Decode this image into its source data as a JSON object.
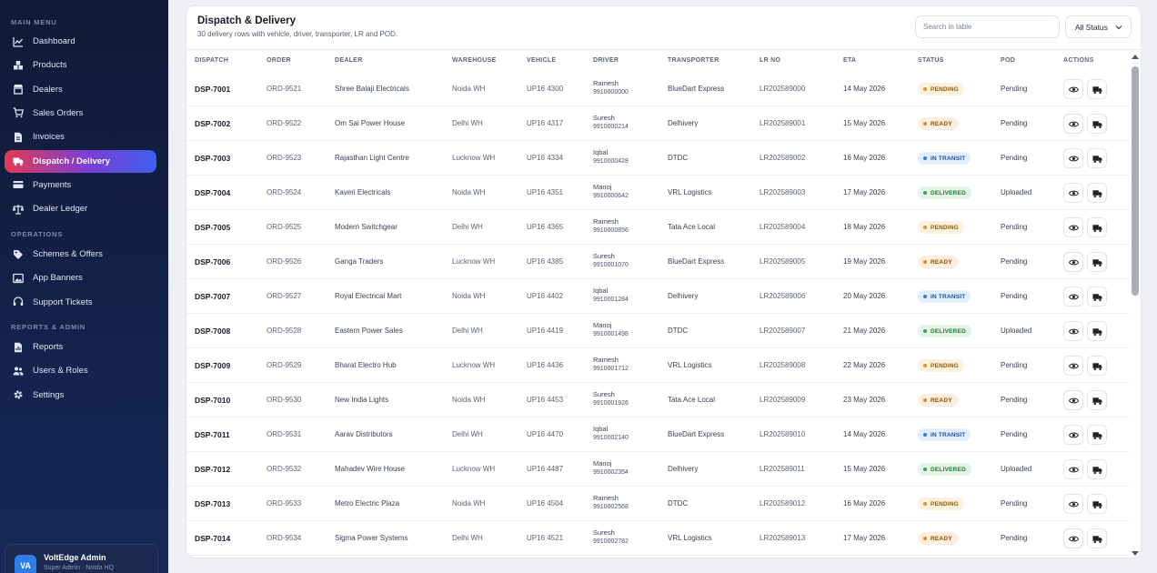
{
  "sidebar": {
    "sections": [
      {
        "label": "MAIN MENU",
        "items": [
          {
            "label": "Dashboard",
            "icon": "chart-line-icon"
          },
          {
            "label": "Products",
            "icon": "boxes-icon"
          },
          {
            "label": "Dealers",
            "icon": "store-icon"
          },
          {
            "label": "Sales Orders",
            "icon": "cart-icon"
          },
          {
            "label": "Invoices",
            "icon": "file-icon"
          },
          {
            "label": "Dispatch / Delivery",
            "icon": "truck-icon",
            "active": true
          },
          {
            "label": "Payments",
            "icon": "card-icon"
          },
          {
            "label": "Dealer Ledger",
            "icon": "scale-icon"
          }
        ]
      },
      {
        "label": "OPERATIONS",
        "items": [
          {
            "label": "Schemes & Offers",
            "icon": "tag-icon"
          },
          {
            "label": "App Banners",
            "icon": "image-icon"
          },
          {
            "label": "Support Tickets",
            "icon": "headset-icon"
          }
        ]
      },
      {
        "label": "REPORTS & ADMIN",
        "items": [
          {
            "label": "Reports",
            "icon": "report-icon"
          },
          {
            "label": "Users & Roles",
            "icon": "users-icon"
          },
          {
            "label": "Settings",
            "icon": "gear-icon"
          }
        ]
      }
    ],
    "user": {
      "initials": "VA",
      "name": "VoltEdge Admin",
      "role": "Super Admin · Noida HQ"
    }
  },
  "main": {
    "title": "Dispatch & Delivery",
    "subtitle": "30 delivery rows with vehicle, driver, transporter, LR and POD.",
    "search_placeholder": "Search in table",
    "status_filter": "All Status",
    "columns": [
      "DISPATCH",
      "ORDER",
      "DEALER",
      "WAREHOUSE",
      "VEHICLE",
      "DRIVER",
      "TRANSPORTER",
      "LR NO",
      "ETA",
      "STATUS",
      "POD",
      "ACTIONS"
    ],
    "rows": [
      {
        "dispatch": "DSP-7001",
        "order": "ORD-9521",
        "dealer": "Shree Balaji Electricals",
        "warehouse": "Noida WH",
        "vehicle": "UP16 4300",
        "driver": "Ramesh",
        "phone": "9910000000",
        "transporter": "BlueDart Express",
        "lr": "LR202589000",
        "eta": "14 May 2026",
        "status": "PENDING",
        "pod": "Pending"
      },
      {
        "dispatch": "DSP-7002",
        "order": "ORD-9522",
        "dealer": "Om Sai Power House",
        "warehouse": "Delhi WH",
        "vehicle": "UP16 4317",
        "driver": "Suresh",
        "phone": "9910000214",
        "transporter": "Delhivery",
        "lr": "LR202589001",
        "eta": "15 May 2026",
        "status": "READY",
        "pod": "Pending"
      },
      {
        "dispatch": "DSP-7003",
        "order": "ORD-9523",
        "dealer": "Rajasthan Light Centre",
        "warehouse": "Lucknow WH",
        "vehicle": "UP16 4334",
        "driver": "Iqbal",
        "phone": "9910000428",
        "transporter": "DTDC",
        "lr": "LR202589002",
        "eta": "16 May 2026",
        "status": "IN TRANSIT",
        "pod": "Pending"
      },
      {
        "dispatch": "DSP-7004",
        "order": "ORD-9524",
        "dealer": "Kaveri Electricals",
        "warehouse": "Noida WH",
        "vehicle": "UP16 4351",
        "driver": "Manoj",
        "phone": "9910000642",
        "transporter": "VRL Logistics",
        "lr": "LR202589003",
        "eta": "17 May 2026",
        "status": "DELIVERED",
        "pod": "Uploaded"
      },
      {
        "dispatch": "DSP-7005",
        "order": "ORD-9525",
        "dealer": "Modern Switchgear",
        "warehouse": "Delhi WH",
        "vehicle": "UP16 4365",
        "driver": "Ramesh",
        "phone": "9910000856",
        "transporter": "Tata Ace Local",
        "lr": "LR202589004",
        "eta": "18 May 2026",
        "status": "PENDING",
        "pod": "Pending"
      },
      {
        "dispatch": "DSP-7006",
        "order": "ORD-9526",
        "dealer": "Ganga Traders",
        "warehouse": "Lucknow WH",
        "vehicle": "UP16 4385",
        "driver": "Suresh",
        "phone": "9910001070",
        "transporter": "BlueDart Express",
        "lr": "LR202589005",
        "eta": "19 May 2026",
        "status": "READY",
        "pod": "Pending"
      },
      {
        "dispatch": "DSP-7007",
        "order": "ORD-9527",
        "dealer": "Royal Electrical Mart",
        "warehouse": "Noida WH",
        "vehicle": "UP16 4402",
        "driver": "Iqbal",
        "phone": "9910001284",
        "transporter": "Delhivery",
        "lr": "LR202589006",
        "eta": "20 May 2026",
        "status": "IN TRANSIT",
        "pod": "Pending"
      },
      {
        "dispatch": "DSP-7008",
        "order": "ORD-9528",
        "dealer": "Eastern Power Sales",
        "warehouse": "Delhi WH",
        "vehicle": "UP16 4419",
        "driver": "Manoj",
        "phone": "9910001498",
        "transporter": "DTDC",
        "lr": "LR202589007",
        "eta": "21 May 2026",
        "status": "DELIVERED",
        "pod": "Uploaded"
      },
      {
        "dispatch": "DSP-7009",
        "order": "ORD-9529",
        "dealer": "Bharat Electro Hub",
        "warehouse": "Lucknow WH",
        "vehicle": "UP16 4436",
        "driver": "Ramesh",
        "phone": "9910001712",
        "transporter": "VRL Logistics",
        "lr": "LR202589008",
        "eta": "22 May 2026",
        "status": "PENDING",
        "pod": "Pending"
      },
      {
        "dispatch": "DSP-7010",
        "order": "ORD-9530",
        "dealer": "New India Lights",
        "warehouse": "Noida WH",
        "vehicle": "UP16 4453",
        "driver": "Suresh",
        "phone": "9910001926",
        "transporter": "Tata Ace Local",
        "lr": "LR202589009",
        "eta": "23 May 2026",
        "status": "READY",
        "pod": "Pending"
      },
      {
        "dispatch": "DSP-7011",
        "order": "ORD-9531",
        "dealer": "Aarav Distributors",
        "warehouse": "Delhi WH",
        "vehicle": "UP16 4470",
        "driver": "Iqbal",
        "phone": "9910002140",
        "transporter": "BlueDart Express",
        "lr": "LR202589010",
        "eta": "14 May 2026",
        "status": "IN TRANSIT",
        "pod": "Pending"
      },
      {
        "dispatch": "DSP-7012",
        "order": "ORD-9532",
        "dealer": "Mahadev Wire House",
        "warehouse": "Lucknow WH",
        "vehicle": "UP16 4487",
        "driver": "Manoj",
        "phone": "9910002354",
        "transporter": "Delhivery",
        "lr": "LR202589011",
        "eta": "15 May 2026",
        "status": "DELIVERED",
        "pod": "Uploaded"
      },
      {
        "dispatch": "DSP-7013",
        "order": "ORD-9533",
        "dealer": "Metro Electric Plaza",
        "warehouse": "Noida WH",
        "vehicle": "UP16 4504",
        "driver": "Ramesh",
        "phone": "9910002568",
        "transporter": "DTDC",
        "lr": "LR202589012",
        "eta": "16 May 2026",
        "status": "PENDING",
        "pod": "Pending"
      },
      {
        "dispatch": "DSP-7014",
        "order": "ORD-9534",
        "dealer": "Sigma Power Systems",
        "warehouse": "Delhi WH",
        "vehicle": "UP16 4521",
        "driver": "Suresh",
        "phone": "9910002782",
        "transporter": "VRL Logistics",
        "lr": "LR202589013",
        "eta": "17 May 2026",
        "status": "READY",
        "pod": "Pending"
      }
    ]
  }
}
